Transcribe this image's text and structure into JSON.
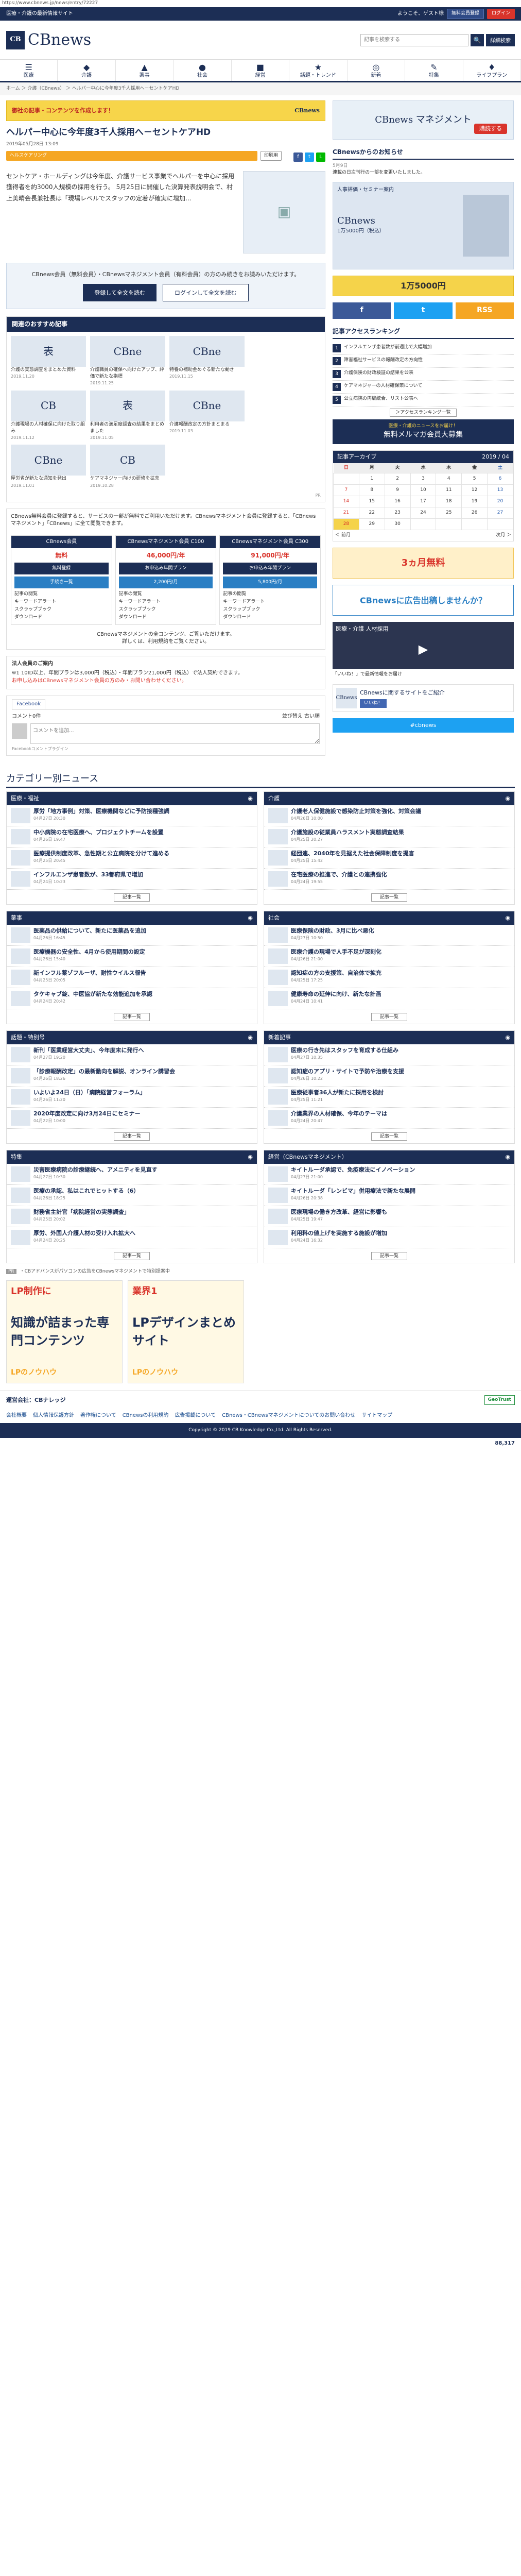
{
  "urlbar": "https://www.cbnews.jp/news/entry/72227",
  "topbar": {
    "tagline": "医療・介護の最新情報サイト",
    "welcome": "ようこそ、ゲスト様",
    "member": "無料会員登録",
    "login": "ログイン"
  },
  "logo": {
    "mark": "CB",
    "name": "CBnews"
  },
  "search": {
    "placeholder": "記事を検索する",
    "go": "🔍",
    "advanced": "詳細検索"
  },
  "nav": [
    {
      "icon": "☰",
      "label": "医療"
    },
    {
      "icon": "◆",
      "label": "介護"
    },
    {
      "icon": "▲",
      "label": "薬事"
    },
    {
      "icon": "●",
      "label": "社会"
    },
    {
      "icon": "■",
      "label": "経営"
    },
    {
      "icon": "★",
      "label": "話題・トレンド"
    },
    {
      "icon": "◎",
      "label": "新着"
    },
    {
      "icon": "✎",
      "label": "特集"
    },
    {
      "icon": "♦",
      "label": "ライフプラン"
    }
  ],
  "breadcrumb": "ホーム ＞ 介護（CBnews） ＞ ヘルパー中心に今年度3千人採用へ－セントケアHD",
  "banner": {
    "text": "御社の記事・コンテンツを作成します！",
    "brand": "CBnews"
  },
  "article": {
    "title": "ヘルパー中心に今年度3千人採用へ－セントケアHD",
    "date": "2019年05月28日 13:09",
    "category": "ヘルスケアリング",
    "tag": "印刷用",
    "lead": "セントケア・ホールディングは今年度、介護サービス事業でヘルパーを中心に採用獲得者を約3000人規模の採用を行う。 5月25日に開催した決算発表説明会で、村上美晴会長兼社長は「現場レベルでスタッフの定着が確実に増加...",
    "member_msg": "CBnews会員（無料会員）・CBnewsマネジメント会員（有料会員）の方のみ続きをお読みいただけます。",
    "btn_register": "登録して全文を読む",
    "btn_login": "ログインして全文を読む"
  },
  "related": {
    "title": "関連のおすすめ記事",
    "items": [
      {
        "thumb": "表",
        "title": "介護の実態調査をまとめた資料",
        "date": "2019.11.20"
      },
      {
        "thumb": "CBne",
        "title": "介護職員の確保へ向けたアップ、評価で新たな指標",
        "date": "2019.11.25"
      },
      {
        "thumb": "CBne",
        "title": "特養の補助金めぐる新たな動き",
        "date": "2019.11.15"
      },
      {
        "thumb": "CB",
        "title": "介護現場の人材確保に向けた取り組み",
        "date": "2019.11.12"
      },
      {
        "thumb": "表",
        "title": "利用者の満足度調査の結果をまとめました",
        "date": "2019.11.05"
      },
      {
        "thumb": "CBne",
        "title": "介護報酬改定の方針まとまる",
        "date": "2019.11.03"
      },
      {
        "thumb": "CBne",
        "title": "厚労省が新たな通知を発出",
        "date": "2019.11.01"
      },
      {
        "thumb": "CB",
        "title": "ケアマネジャー向けの研修を拡充",
        "date": "2019.10.28"
      }
    ],
    "pr": "PR"
  },
  "plans": {
    "intro": "CBnews無料会員に登録すると、サービスの一部が無料でご利用いただけます。CBnewsマネジメント会員に登録すると、「CBnewsマネジメント」「CBnews」に全て閲覧できます。",
    "list": [
      {
        "name": "CBnews会員",
        "price": "無料",
        "btn": "無料登録",
        "btn2": "手続き一覧"
      },
      {
        "name": "CBnewsマネジメント会員 C100",
        "price": "46,000円/年",
        "btn": "お申込み年間プラン",
        "btn2": "2,200円/月"
      },
      {
        "name": "CBnewsマネジメント会員 C300",
        "price": "91,000円/年",
        "btn": "お申込み年間プラン",
        "btn2": "5,800円/月"
      }
    ],
    "features": [
      "記事の閲覧",
      "キーワードアラート",
      "スクラップブック",
      "ダウンロード"
    ],
    "note": "CBnewsマネジメントの全コンテンツ、ご覧いただけます。",
    "note2": "詳しくは、利用規約をご覧ください。"
  },
  "trial": {
    "title": "法人会員のご案内",
    "text": "※1 10ID以上、年間プランは3,000円（税込）・年間プラン21,000円（税込）で法人契約できます。",
    "red": "お申し込みはCBnewsマネジメント会員の方のみ・お問い合わせください。"
  },
  "fb": {
    "tab": "Facebook",
    "count": "コメント0件",
    "sort": "並び替え 古い順",
    "placeholder": "コメントを追加...",
    "plugin": "Facebookコメントプラグイン"
  },
  "cats_title": "カテゴリー別ニュース",
  "cats": [
    {
      "name": "医療・福祉",
      "items": [
        {
          "title": "厚労「地方事例」対策、医療機関などに予防接種強調",
          "date": "04月27日 20:30"
        },
        {
          "title": "中小病院の在宅医療へ、プロジェクトチームを設置",
          "date": "04月26日 19:47"
        },
        {
          "title": "医療提供制度改革、急性期と公立病院を分けて進める",
          "date": "04月25日 20:45"
        },
        {
          "title": "インフルエンザ患者数が、33都府県で増加",
          "date": "04月24日 10:23"
        }
      ],
      "more": "記事一覧"
    },
    {
      "name": "介護",
      "items": [
        {
          "title": "介護老人保健施設で感染防止対策を強化、対策会議",
          "date": "04月26日 10:00"
        },
        {
          "title": "介護施設の従業員ハラスメント実態調査結果",
          "date": "04月25日 20:27"
        },
        {
          "title": "経団連、2040年を見据えた社会保障制度を提言",
          "date": "04月25日 15:42"
        },
        {
          "title": "在宅医療の推進で、介護との連携強化",
          "date": "04月24日 19:55"
        }
      ],
      "more": "記事一覧"
    },
    {
      "name": "薬事",
      "items": [
        {
          "title": "医薬品の供給について、新たに医薬品を追加",
          "date": "04月26日 16:45"
        },
        {
          "title": "医療機器の安全性、4月から使用期間の設定",
          "date": "04月26日 15:40"
        },
        {
          "title": "新インフル薬ゾフルーザ、耐性ウイルス報告",
          "date": "04月25日 20:05"
        },
        {
          "title": "タケキャブ錠、中医協が新たな効能追加を承認",
          "date": "04月24日 20:42"
        }
      ],
      "more": "記事一覧"
    },
    {
      "name": "社会",
      "items": [
        {
          "title": "医療保険の財政、3月に比べ悪化",
          "date": "04月27日 10:50"
        },
        {
          "title": "医療介護の現場で人手不足が深刻化",
          "date": "04月26日 21:00"
        },
        {
          "title": "認知症の方の支援策、自治体で拡充",
          "date": "04月25日 17:25"
        },
        {
          "title": "健康寿命の延伸に向け、新たな計画",
          "date": "04月24日 10:41"
        }
      ],
      "more": "記事一覧"
    },
    {
      "name": "話題・特別号",
      "items": [
        {
          "title": "新刊「医業経営大丈夫」、今年度末に発行へ",
          "date": "04月27日 19:20"
        },
        {
          "title": "「診療報酬改定」の最新動向を解説、オンライン講習会",
          "date": "04月26日 18:26"
        },
        {
          "title": "いよいよ24日（日）「病院経営フォーラム」",
          "date": "04月26日 11:20"
        },
        {
          "title": "2020年度改定に向け3月24日にセミナー",
          "date": "04月22日 10:00"
        }
      ],
      "more": "記事一覧"
    },
    {
      "name": "新着記事",
      "items": [
        {
          "title": "医療の行き先はスタッフを育成する仕組み",
          "date": "04月27日 10:35"
        },
        {
          "title": "認知症のアプリ・サイトで予防や治療を支援",
          "date": "04月26日 10:22"
        },
        {
          "title": "医療従事者36人が新たに採用を検討",
          "date": "04月25日 11:21"
        },
        {
          "title": "介護業界の人材確保、今年のテーマは",
          "date": "04月24日 20:47"
        }
      ],
      "more": "記事一覧"
    },
    {
      "name": "特集",
      "items": [
        {
          "title": "災害医療病院の診療継続へ、アメニティを見直す",
          "date": "04月27日 10:30"
        },
        {
          "title": "医療の承認、私はこれでヒットする（6）",
          "date": "04月26日 18:25"
        },
        {
          "title": "財務省主計官「病院経営の実態調査」",
          "date": "04月25日 20:02"
        },
        {
          "title": "厚労、外国人介護人材の受け入れ拡大へ",
          "date": "04月24日 20:25"
        }
      ],
      "more": "記事一覧"
    },
    {
      "name": "経営（CBnewsマネジメント）",
      "items": [
        {
          "title": "キイトルーダ承認で、免疫療法にイノベーション",
          "date": "04月27日 21:00"
        },
        {
          "title": "キイトルーダ「レンビマ」併用療法で新たな展開",
          "date": "04月26日 20:38"
        },
        {
          "title": "医療現場の働き方改革、経営に影響も",
          "date": "04月25日 19:47"
        },
        {
          "title": "利用料の値上げを実施する施設が増加",
          "date": "04月24日 16:32"
        }
      ],
      "more": "記事一覧"
    }
  ],
  "side": {
    "ad1": {
      "brand": "CBnews マネジメント",
      "pill": "購読する"
    },
    "notice_title": "CBnewsからのお知らせ",
    "notice_date": "5月9日",
    "notice_text": "連載の日次刊行の一部を変更いたしました。",
    "bigad_top": "人事評価・セミナー案内",
    "bigad_title": "CBnews",
    "bigad_sub": "1万5000円（税込）",
    "yelad": "1万5000円",
    "social": [
      {
        "label": "f",
        "color": "#3b5998"
      },
      {
        "label": "t",
        "color": "#1da1f2"
      },
      {
        "label": "RSS",
        "color": "#f5a623"
      }
    ],
    "rank_title": "記事アクセスランキング",
    "rank": [
      "インフルエンザ患者数が前週比で大幅増加",
      "障害福祉サービスの報酬改定の方向性",
      "介護保険の財政検証の結果を公表",
      "ケアマネジャーの人材確保策について",
      "公立病院の再編統合、リスト公表へ"
    ],
    "rank_more": "＞アクセスランキング一覧",
    "mailad": "無料メルマガ会員大募集",
    "mailad_sub": "医療・介護のニュースをお届け！",
    "cal": {
      "title": "記事アーカイブ",
      "month": "2019 / 04",
      "days": [
        "日",
        "月",
        "火",
        "水",
        "木",
        "金",
        "土"
      ],
      "rows": [
        [
          "",
          "1",
          "2",
          "3",
          "4",
          "5",
          "6"
        ],
        [
          "7",
          "8",
          "9",
          "10",
          "11",
          "12",
          "13"
        ],
        [
          "14",
          "15",
          "16",
          "17",
          "18",
          "19",
          "20"
        ],
        [
          "21",
          "22",
          "23",
          "24",
          "25",
          "26",
          "27"
        ],
        [
          "28",
          "29",
          "30",
          "",
          "",
          "",
          ""
        ]
      ],
      "prev": "＜ 前月",
      "next": "次月 ＞"
    },
    "freead": "3ヵ月無料",
    "adad": "CBnewsに広告出稿しませんか？",
    "vid_title": "医療・介護 人材採用",
    "vid_cap": "「いいね！」で最新情報をお届け",
    "fbw_name": "CBnews",
    "fbw_btn": "いいね！",
    "fbw_text": "CBnewsに関するサイトをご紹介",
    "twbtn": "#cbnews"
  },
  "footer": {
    "pr": "PR",
    "prtext": "・CBアドバンスがパソコンの広告をCBnewsマネジメントで特別提案中",
    "ad1_t": "LP制作に",
    "ad1_s": "知識が詰まった専門コンテンツ",
    "ad1_b": "LPのノウハウ",
    "ad2_t": "業界1",
    "ad2_s": "LPデザインまとめサイト",
    "ad2_b": "LPのノウハウ",
    "company": "運営会社：CBナレッジ",
    "ssl": "GeoTrust",
    "links": [
      "会社概要",
      "個人情報保護方針",
      "著作権について",
      "CBnewsの利用規約",
      "広告掲載について",
      "CBnews・CBnewsマネジメントについてのお問い合わせ",
      "サイトマップ"
    ],
    "copyright": "Copyright © 2019 CB Knowledge Co.,Ltd. All Rights Reserved.",
    "bottom": "88,317"
  }
}
